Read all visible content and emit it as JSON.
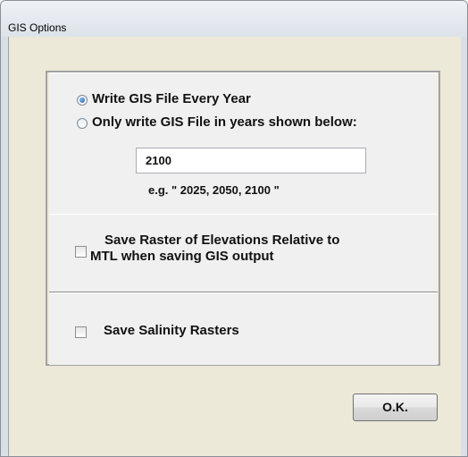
{
  "window": {
    "title": "GIS Options"
  },
  "gis_file": {
    "option_every_year": "Write GIS File Every Year",
    "option_selected_years": "Only write GIS File in years shown below:",
    "selected_option": "every_year",
    "years_value": "2100",
    "years_hint": "e.g. \" 2025, 2050, 2100 \""
  },
  "raster_elevations": {
    "label_line1": "Save Raster of Elevations Relative to",
    "label_line2": "MTL when saving GIS output",
    "checked": false
  },
  "salinity": {
    "label": "Save Salinity Rasters",
    "checked": false
  },
  "buttons": {
    "ok_label": "O.K."
  }
}
